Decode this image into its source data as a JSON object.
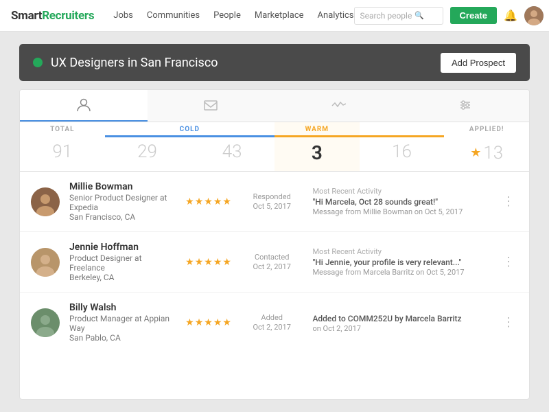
{
  "app": {
    "logo_smart": "Smart",
    "logo_recruiters": "Recruiters"
  },
  "nav": {
    "links": [
      "Jobs",
      "Communities",
      "People",
      "Marketplace",
      "Analytics"
    ],
    "search_placeholder": "Search people",
    "create_label": "Create"
  },
  "banner": {
    "title": "UX Designers in San Francisco",
    "add_prospect_label": "Add Prospect"
  },
  "tabs": [
    {
      "id": "people",
      "icon": "👤"
    },
    {
      "id": "messages",
      "icon": "✉"
    },
    {
      "id": "activity",
      "icon": "〰"
    },
    {
      "id": "settings",
      "icon": "⚙"
    }
  ],
  "stats": {
    "total_label": "TOTAL",
    "cold_label": "COLD",
    "warm_label": "WARM",
    "applied_label": "APPLIED!",
    "total_value": "91",
    "cold_values": [
      "29",
      "43"
    ],
    "warm_active": "3",
    "warm_other": "16",
    "applied_value": "13"
  },
  "candidates": [
    {
      "name": "Millie Bowman",
      "title": "Senior Product Designer at Expedia",
      "location": "San Francisco, CA",
      "stars": 5,
      "activity_status": "Responded",
      "activity_date": "Oct 5, 2017",
      "msg_label": "Most Recent Activity",
      "msg_quote": "\"Hi Marcela, Oct 28 sounds great!\"",
      "msg_source": "Message from Millie Bowman on Oct 5, 2017",
      "avatar_color": "#8B6347"
    },
    {
      "name": "Jennie Hoffman",
      "title": "Product Designer at Freelance",
      "location": "Berkeley, CA",
      "stars": 5,
      "activity_status": "Contacted",
      "activity_date": "Oct 2, 2017",
      "msg_label": "Most Recent Activity",
      "msg_quote": "\"Hi Jennie, your profile is very relevant...\"",
      "msg_source": "Message from Marcela Barritz on Oct 5, 2017",
      "avatar_color": "#C8956A"
    },
    {
      "name": "Billy Walsh",
      "title": "Product Manager at Appian Way",
      "location": "San Pablo, CA",
      "stars": 5,
      "activity_status": "Added",
      "activity_date": "Oct 2, 2017",
      "msg_label": "",
      "msg_quote": "Added to COMM252U by Marcela Barritz",
      "msg_source": "on Oct 2, 2017",
      "avatar_color": "#6B8E6B"
    }
  ]
}
